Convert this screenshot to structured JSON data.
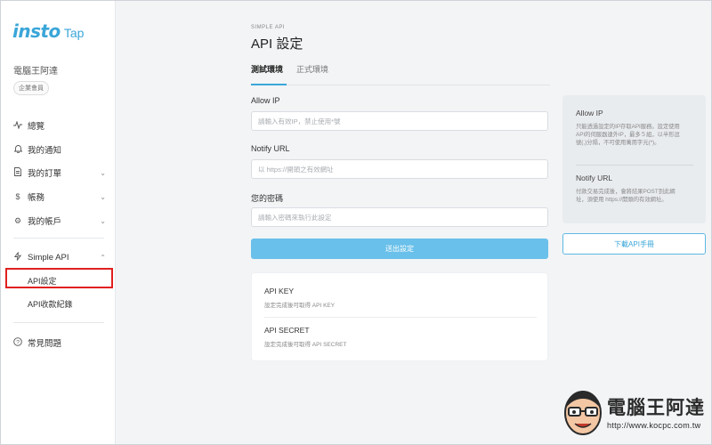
{
  "brand": {
    "logo_main": "insto",
    "logo_sub": "Tap"
  },
  "account": {
    "company": "電腦王阿達",
    "badge": "企業會員"
  },
  "nav": {
    "overview": "總覽",
    "notifications": "我的通知",
    "orders": "我的訂單",
    "finance": "帳務",
    "account": "我的帳戶",
    "simple_api": "Simple API",
    "api_settings": "API設定",
    "api_payment_records": "API收款紀錄",
    "faq": "常見問題"
  },
  "header": {
    "kicker": "SIMPLE API",
    "title": "API 設定"
  },
  "tabs": {
    "test": "測試環境",
    "production": "正式環境"
  },
  "form": {
    "allow_ip_label": "Allow IP",
    "allow_ip_placeholder": "請輸入有效IP，禁止使用*號",
    "notify_url_label": "Notify URL",
    "notify_url_placeholder": "以 https://開頭之有效網址",
    "password_label": "您的密碼",
    "password_placeholder": "請輸入密碼來執行此設定",
    "submit": "送出設定"
  },
  "keys": {
    "api_key_title": "API KEY",
    "api_key_desc": "設定完成後可取得 API KEY",
    "api_secret_title": "API SECRET",
    "api_secret_desc": "設定完成後可取得 API SECRET"
  },
  "info": {
    "allow_ip_title": "Allow IP",
    "allow_ip_text": "只能透過設定的IP存取API服務。設定使用API的伺服器連外IP，最多５組，以半形逗號(,)分隔，不可使用萬用字元(*)。",
    "notify_url_title": "Notify URL",
    "notify_url_text": "付款交易完成後，會將結果POST到此網址，須使用 https://開頭的有效網址。"
  },
  "download_button": "下載API手冊",
  "watermark": {
    "title": "電腦王阿達",
    "url": "http://www.kocpc.com.tw"
  },
  "colors": {
    "accent": "#3aa6d8",
    "button": "#69c0ea",
    "highlight": "#e0201e"
  },
  "icons": {
    "overview": "activity-icon",
    "notifications": "bell-icon",
    "orders": "document-icon",
    "finance": "dollar-icon",
    "account": "gear-icon",
    "simple_api": "lightning-icon",
    "faq": "question-circle-icon"
  }
}
